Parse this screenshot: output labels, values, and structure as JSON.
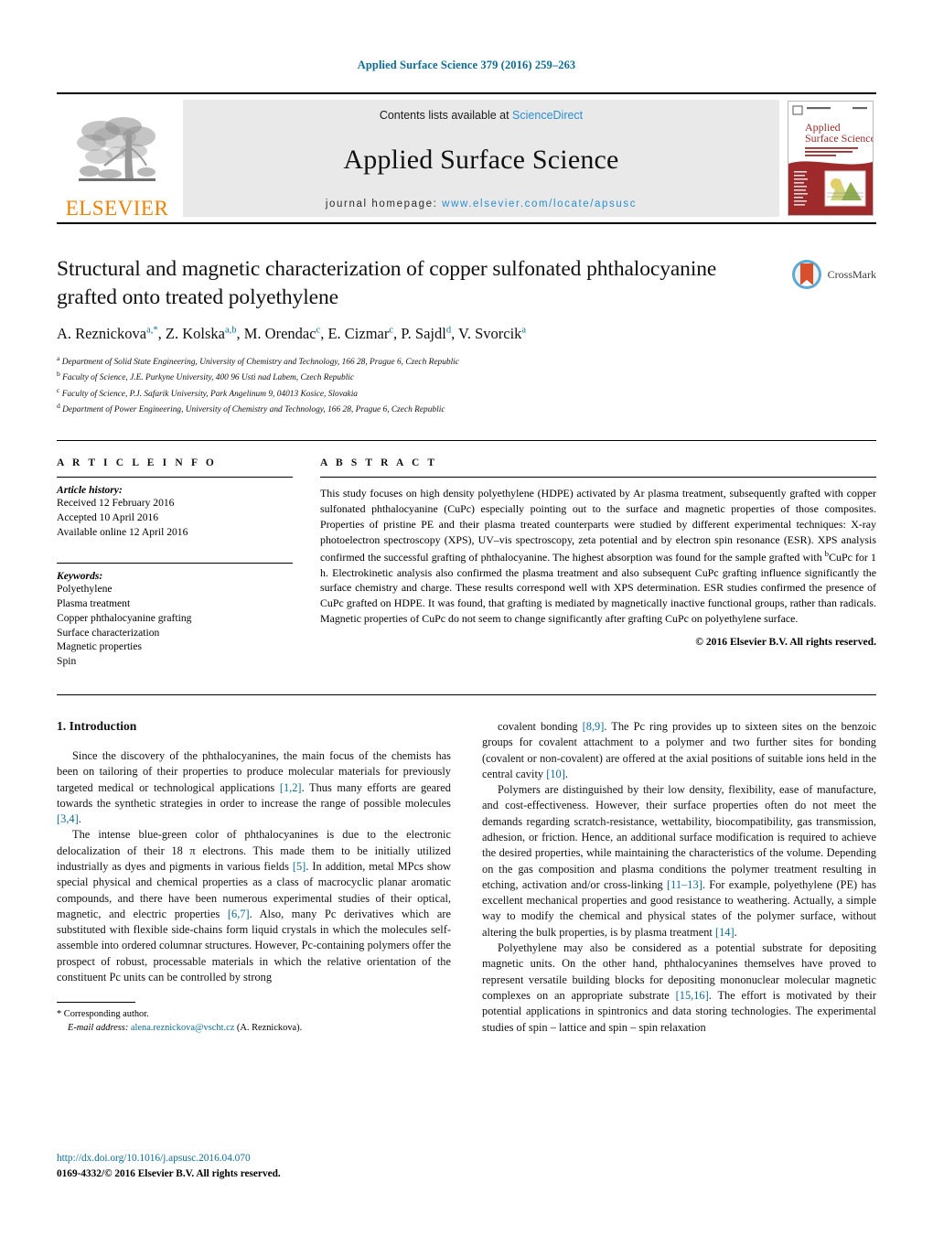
{
  "running_head": "Applied Surface Science 379 (2016) 259–263",
  "masthead": {
    "publisher_name": "ELSEVIER",
    "contents_prefix": "Contents lists available at ",
    "contents_link": "ScienceDirect",
    "journal_title": "Applied Surface Science",
    "homepage_prefix": "journal homepage: ",
    "homepage_url": "www.elsevier.com/locate/apsusc",
    "cover_title_line1": "Applied",
    "cover_title_line2": "Surface Science"
  },
  "article": {
    "title": "Structural and magnetic characterization of copper sulfonated phthalocyanine grafted onto treated polyethylene",
    "crossmark_label": "CrossMark",
    "authors_html": "A. Reznickova<sup>a,*</sup>, Z. Kolska<sup>a,b</sup>, M. Orendac<sup>c</sup>, E. Cizmar<sup>c</sup>, P. Sajdl<sup>d</sup>, V. Svorcik<sup>a</sup>",
    "affiliations": [
      {
        "marker": "a",
        "text": "Department of Solid State Engineering, University of Chemistry and Technology, 166 28, Prague 6, Czech Republic"
      },
      {
        "marker": "b",
        "text": "Faculty of Science, J.E. Purkyne University, 400 96 Usti nad Labem, Czech Republic"
      },
      {
        "marker": "c",
        "text": "Faculty of Science, P.J. Safarik University, Park Angelinum 9, 04013 Kosice, Slovakia"
      },
      {
        "marker": "d",
        "text": "Department of Power Engineering, University of Chemistry and Technology, 166 28, Prague 6, Czech Republic"
      }
    ]
  },
  "article_info": {
    "heading": "A R T I C L E   I N F O",
    "history_title": "Article history:",
    "history": [
      "Received 12 February 2016",
      "Accepted 10 April 2016",
      "Available online 12 April 2016"
    ],
    "keywords_title": "Keywords:",
    "keywords": [
      "Polyethylene",
      "Plasma treatment",
      "Copper phthalocyanine grafting",
      "Surface characterization",
      "Magnetic properties",
      "Spin"
    ]
  },
  "abstract": {
    "heading": "A B S T R A C T",
    "text_html": "This study focuses on high density polyethylene (HDPE) activated by Ar plasma treatment, subsequently grafted with copper sulfonated phthalocyanine (CuPc) especially pointing out to the surface and magnetic properties of those composites. Properties of pristine PE and their plasma treated counterparts were studied by different experimental techniques: X-ray photoelectron spectroscopy (XPS), UV–vis spectroscopy, zeta potential and by electron spin resonance (ESR). XPS analysis confirmed the successful grafting of phthalocyanine. The highest absorption was found for the sample grafted with <sup>b</sup>CuPc for 1 h. Electrokinetic analysis also confirmed the plasma treatment and also subsequent CuPc grafting influence significantly the surface chemistry and charge. These results correspond well with XPS determination. ESR studies confirmed the presence of CuPc grafted on HDPE. It was found, that grafting is mediated by magnetically inactive functional groups, rather than radicals. Magnetic properties of CuPc do not seem to change significantly after grafting CuPc on polyethylene surface.",
    "copyright": "© 2016 Elsevier B.V. All rights reserved."
  },
  "body": {
    "section_title": "1.  Introduction",
    "left_paragraphs_html": [
      "Since the discovery of the phthalocyanines, the main focus of the chemists has been on tailoring of their properties to produce molecular materials for previously targeted medical or technological applications <span class=\"ref\">[1,2]</span>. Thus many efforts are geared towards the synthetic strategies in order to increase the range of possible molecules <span class=\"ref\">[3,4]</span>.",
      "The intense blue-green color of phthalocyanines is due to the electronic delocalization of their 18 π electrons. This made them to be initially utilized industrially as dyes and pigments in various fields <span class=\"ref\">[5]</span>. In addition, metal MPcs show special physical and chemical properties as a class of macrocyclic planar aromatic compounds, and there have been numerous experimental studies of their optical, magnetic, and electric properties <span class=\"ref\">[6,7]</span>. Also, many Pc derivatives which are substituted with flexible side-chains form liquid crystals in which the molecules self-assemble into ordered columnar structures. However, Pc-containing polymers offer the prospect of robust, processable materials in which the relative orientation of the constituent Pc units can be controlled by strong"
    ],
    "right_paragraphs_html": [
      "covalent bonding <span class=\"ref\">[8,9]</span>. The Pc ring provides up to sixteen sites on the benzoic groups for covalent attachment to a polymer and two further sites for bonding (covalent or non-covalent) are offered at the axial positions of suitable ions held in the central cavity <span class=\"ref\">[10]</span>.",
      "Polymers are distinguished by their low density, flexibility, ease of manufacture, and cost-effectiveness. However, their surface properties often do not meet the demands regarding scratch-resistance, wettability, biocompatibility, gas transmission, adhesion, or friction. Hence, an additional surface modification is required to achieve the desired properties, while maintaining the characteristics of the volume. Depending on the gas composition and plasma conditions the polymer treatment resulting in etching, activation and/or cross-linking <span class=\"ref\">[11–13]</span>. For example, polyethylene (PE) has excellent mechanical properties and good resistance to weathering. Actually, a simple way to modify the chemical and physical states of the polymer surface, without altering the bulk properties, is by plasma treatment <span class=\"ref\">[14]</span>.",
      "Polyethylene may also be considered as a potential substrate for depositing magnetic units. On the other hand, phthalocyanines themselves have proved to represent versatile building blocks for depositing mononuclear molecular magnetic complexes on an appropriate substrate <span class=\"ref\">[15,16]</span>. The effort is motivated by their potential applications in spintronics and data storing technologies. The experimental studies of spin – lattice and spin – spin relaxation"
    ]
  },
  "footnote": {
    "corresponding": "*  Corresponding author.",
    "email_label": "E-mail address:",
    "email": "alena.reznickova@vscht.cz",
    "email_suffix": "(A. Reznickova)."
  },
  "page_footer": {
    "doi": "http://dx.doi.org/10.1016/j.apsusc.2016.04.070",
    "issn": "0169-4332/© 2016 Elsevier B.V. All rights reserved."
  },
  "colors": {
    "link": "#0b6c93",
    "sciencedirect": "#2b8fd0",
    "elsevier_orange": "#ef8200",
    "cover_red": "#9e2a2b"
  }
}
